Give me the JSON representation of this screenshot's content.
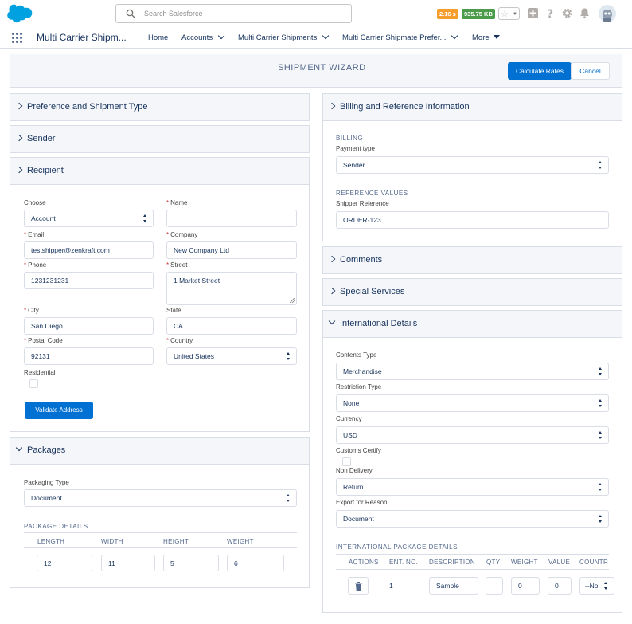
{
  "header": {
    "search_placeholder": "Search Salesforce",
    "timing_badge": "2.16 s",
    "size_badge": "935.75 KB"
  },
  "nav": {
    "app_name": "Multi Carrier Shipm...",
    "items": [
      "Home",
      "Accounts",
      "Multi Carrier Shipments",
      "Multi Carrier Shipmate Prefer...",
      "More"
    ]
  },
  "wizard": {
    "title": "SHIPMENT WIZARD",
    "calculate_label": "Calculate Rates",
    "cancel_label": "Cancel"
  },
  "sections": {
    "preference": "Preference and Shipment Type",
    "sender": "Sender",
    "recipient": "Recipient",
    "packages": "Packages",
    "billing": "Billing and Reference Information",
    "comments": "Comments",
    "special": "Special Services",
    "international": "International Details"
  },
  "recipient": {
    "choose_label": "Choose",
    "choose_value": "Account",
    "name_label": "Name",
    "name_value": "",
    "email_label": "Email",
    "email_value": "testshipper@zenkraft.com",
    "company_label": "Company",
    "company_value": "New Company Ltd",
    "phone_label": "Phone",
    "phone_value": "1231231231",
    "street_label": "Street",
    "street_value": "1 Market Street",
    "city_label": "City",
    "city_value": "San Diego",
    "state_label": "State",
    "state_value": "CA",
    "postal_label": "Postal Code",
    "postal_value": "92131",
    "country_label": "Country",
    "country_value": "United States",
    "residential_label": "Residential",
    "validate_label": "Validate Address"
  },
  "packages": {
    "type_label": "Packaging Type",
    "type_value": "Document",
    "details_label": "PACKAGE DETAILS",
    "columns": [
      "LENGTH",
      "WIDTH",
      "HEIGHT",
      "WEIGHT"
    ],
    "row": [
      "12",
      "11",
      "5",
      "6"
    ]
  },
  "billing": {
    "billing_heading": "BILLING",
    "payment_label": "Payment type",
    "payment_value": "Sender",
    "reference_heading": "REFERENCE VALUES",
    "shipper_ref_label": "Shipper Reference",
    "shipper_ref_value": "ORDER-123"
  },
  "international": {
    "contents_label": "Contents Type",
    "contents_value": "Merchandise",
    "restriction_label": "Restriction Type",
    "restriction_value": "None",
    "currency_label": "Currency",
    "currency_value": "USD",
    "customs_label": "Customs Certify",
    "nondelivery_label": "Non Delivery",
    "nondelivery_value": "Return",
    "export_label": "Export for Reason",
    "export_value": "Document",
    "details_label": "INTERNATIONAL PACKAGE DETAILS",
    "columns": [
      "ACTIONS",
      "ENT. NO.",
      "DESCRIPTION",
      "QTY",
      "WEIGHT",
      "VALUE",
      "COUNTR"
    ],
    "row": {
      "ent_no": "1",
      "description": "Sample",
      "qty": "",
      "weight": "0",
      "value": "0",
      "country": "--No"
    }
  },
  "colors": {
    "brand": "#0070d2",
    "header_bg": "#f4f6f9",
    "border": "#d8dde6",
    "text": "#16325c",
    "required": "#c23934"
  }
}
